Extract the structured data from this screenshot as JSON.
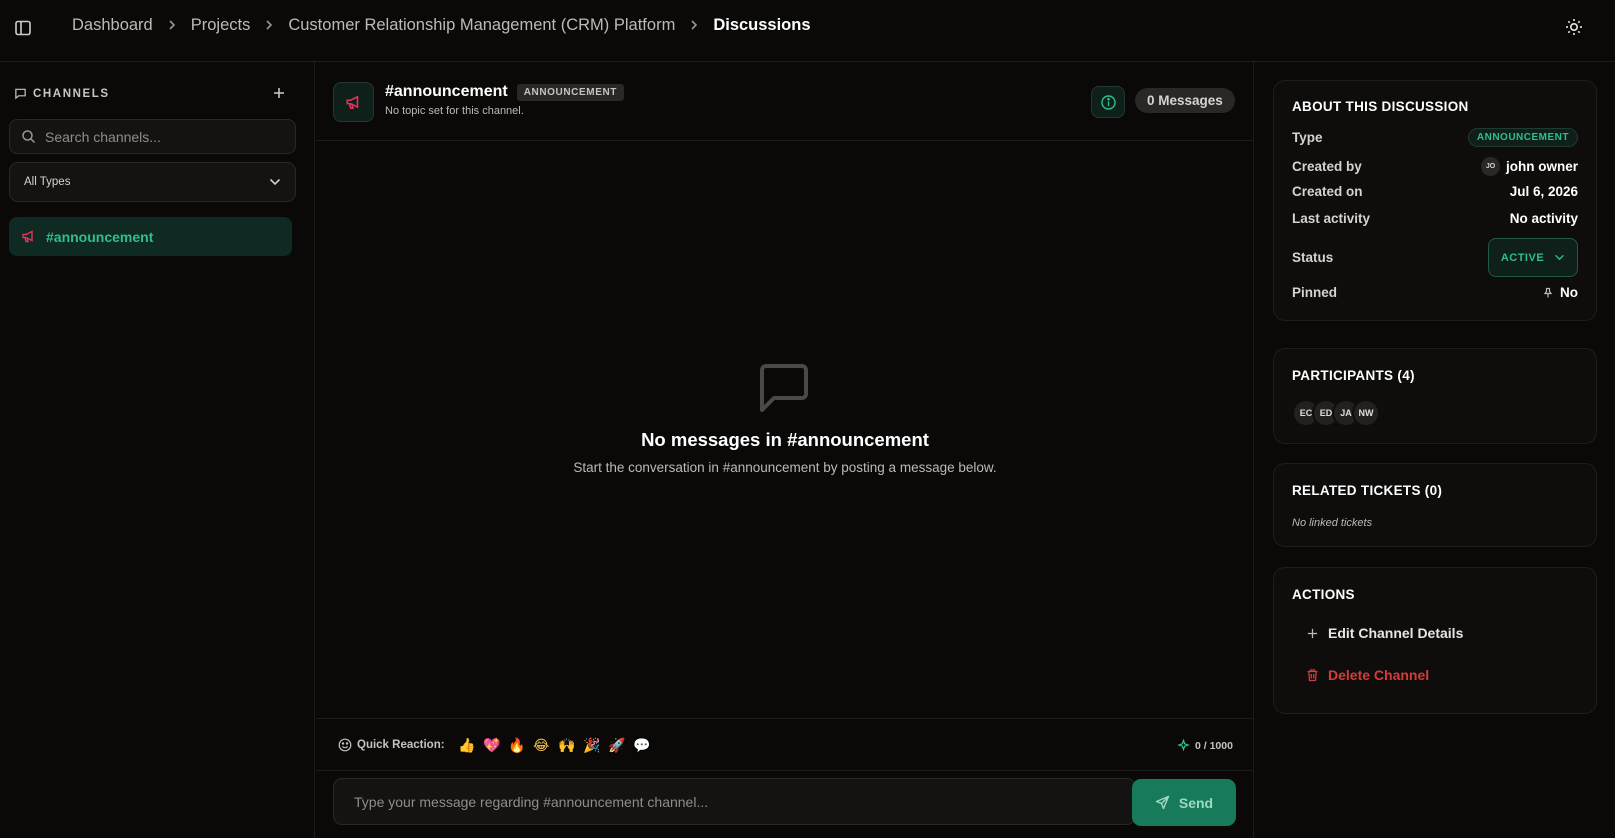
{
  "breadcrumb": {
    "items": [
      "Dashboard",
      "Projects",
      "Customer Relationship Management (CRM) Platform"
    ],
    "current": "Discussions"
  },
  "sidebar": {
    "header": "CHANNELS",
    "search_placeholder": "Search channels...",
    "type_filter": "All Types",
    "channels": [
      {
        "label": "#announcement",
        "active": true
      }
    ]
  },
  "channel": {
    "name": "#announcement",
    "type_badge": "ANNOUNCEMENT",
    "topic": "No topic set for this channel.",
    "message_count": "0 Messages"
  },
  "empty_state": {
    "title": "No messages in #announcement",
    "subtitle": "Start the conversation in #announcement by posting a message below."
  },
  "composer": {
    "quick_reaction_label": "Quick Reaction:",
    "emojis": [
      "👍",
      "💖",
      "🔥",
      "😂",
      "🙌",
      "🎉",
      "🚀",
      "💬"
    ],
    "char_count": "0 / 1000",
    "placeholder": "Type your message regarding #announcement channel...",
    "send_label": "Send"
  },
  "about": {
    "title": "ABOUT THIS DISCUSSION",
    "type_label": "Type",
    "type_value": "ANNOUNCEMENT",
    "created_by_label": "Created by",
    "created_by_initials": "JO",
    "created_by_value": "john owner",
    "created_on_label": "Created on",
    "created_on_value": "Jul 6, 2026",
    "last_activity_label": "Last activity",
    "last_activity_value": "No activity",
    "status_label": "Status",
    "status_value": "ACTIVE",
    "pinned_label": "Pinned",
    "pinned_value": "No"
  },
  "participants": {
    "title": "PARTICIPANTS (4)",
    "initials": [
      "EC",
      "ED",
      "JA",
      "NW"
    ]
  },
  "related_tickets": {
    "title": "RELATED TICKETS (0)",
    "empty": "No linked tickets"
  },
  "actions": {
    "title": "ACTIONS",
    "edit_label": "Edit Channel Details",
    "delete_label": "Delete Channel"
  },
  "colors": {
    "accent": "#2fbf8a",
    "danger": "#d63a3a",
    "background": "#0a0908"
  }
}
